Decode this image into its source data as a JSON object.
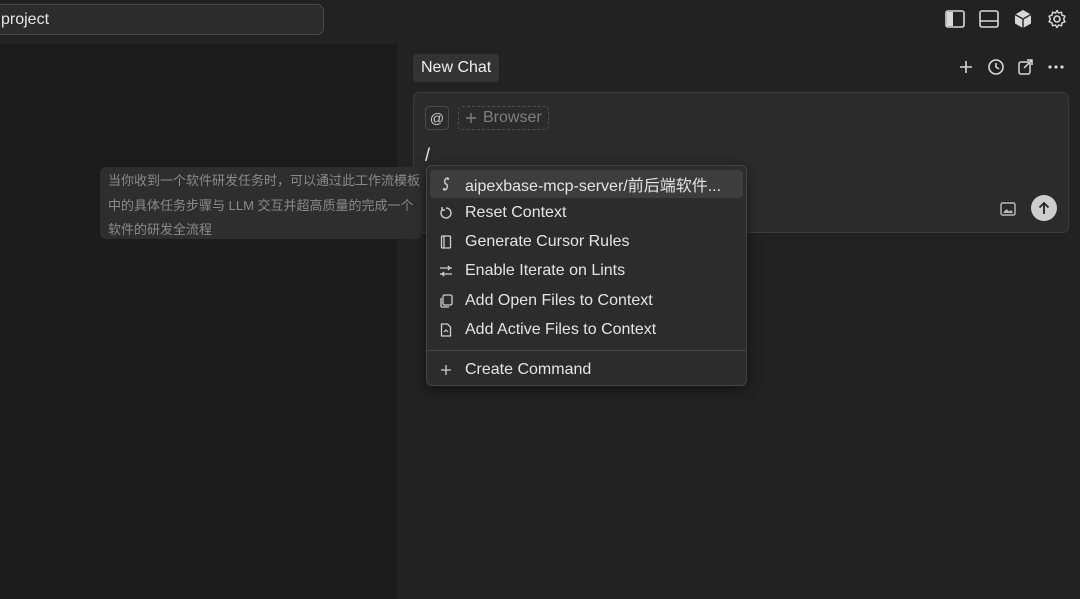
{
  "titlebar": {
    "search_value": "project",
    "icons": [
      "sidebar-left-icon",
      "panel-bottom-icon",
      "cube-icon",
      "gear-icon"
    ]
  },
  "chat": {
    "tab_label": "New Chat",
    "header_icons": [
      "plus-icon",
      "history-icon",
      "export-icon",
      "more-icon"
    ],
    "composer": {
      "at_label": "@",
      "browser_chip_label": "Browser",
      "input_value": "/"
    }
  },
  "tooltip": {
    "lines": [
      "当你收到一个软件研发任务时，可以通过此工作流模板",
      "中的具体任务步骤与 LLM 交互并超高质量的完成一个",
      "软件的研发全流程"
    ]
  },
  "command_menu": {
    "items": [
      {
        "label": "aipexbase-mcp-server/前后端软件...",
        "icon": "flow-icon"
      },
      {
        "label": "Reset Context",
        "icon": "reset-icon"
      },
      {
        "label": "Generate Cursor Rules",
        "icon": "document-icon"
      },
      {
        "label": "Enable Iterate on Lints",
        "icon": "sliders-icon"
      },
      {
        "label": "Add Open Files to Context",
        "icon": "copy-files-icon"
      },
      {
        "label": "Add Active Files to Context",
        "icon": "file-icon"
      }
    ],
    "create_label": "Create Command"
  },
  "colors": {
    "background": "#1b1b1b",
    "panel": "#222222",
    "composer": "#2b2b2b",
    "menu": "#2c2c2c",
    "menu_active": "#3d3d3d",
    "text": "#e4e4e4"
  }
}
